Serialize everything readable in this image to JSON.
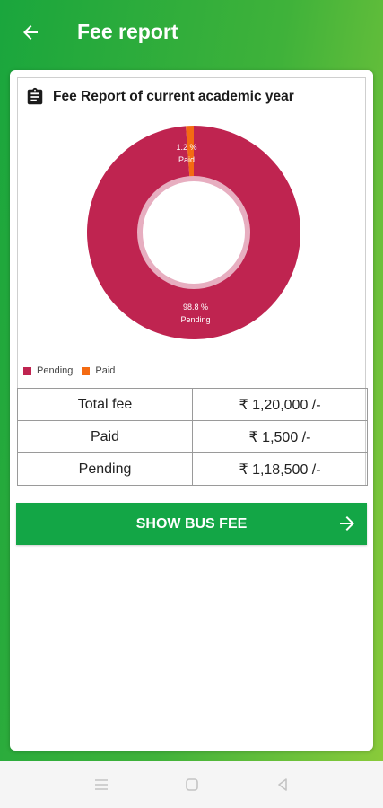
{
  "app_bar": {
    "title": "Fee report",
    "back_icon": "arrow-left-icon"
  },
  "report": {
    "icon": "clipboard-icon",
    "title": "Fee Report of current academic year"
  },
  "chart_data": {
    "type": "pie",
    "style": "donut",
    "slices": [
      {
        "label": "Pending",
        "value": 98.8,
        "value_label": "98.8 %",
        "color": "#bf2450"
      },
      {
        "label": "Paid",
        "value": 1.2,
        "value_label": "1.2 %",
        "color": "#f46b12"
      }
    ],
    "legend": [
      "Pending",
      "Paid"
    ],
    "legend_position": "bottom-left"
  },
  "fee_table": {
    "rows": [
      {
        "label": "Total fee",
        "value": "₹ 1,20,000 /-"
      },
      {
        "label": "Paid",
        "value": "₹ 1,500 /-"
      },
      {
        "label": "Pending",
        "value": "₹ 1,18,500 /-"
      }
    ]
  },
  "bus_button": {
    "label": "SHOW BUS FEE",
    "icon": "arrow-right-icon"
  },
  "nav_bar": {
    "icons": [
      "menu-icon",
      "home-icon",
      "back-icon"
    ]
  },
  "colors": {
    "primary": "#13a646",
    "pending": "#bf2450",
    "paid": "#f46b12"
  }
}
